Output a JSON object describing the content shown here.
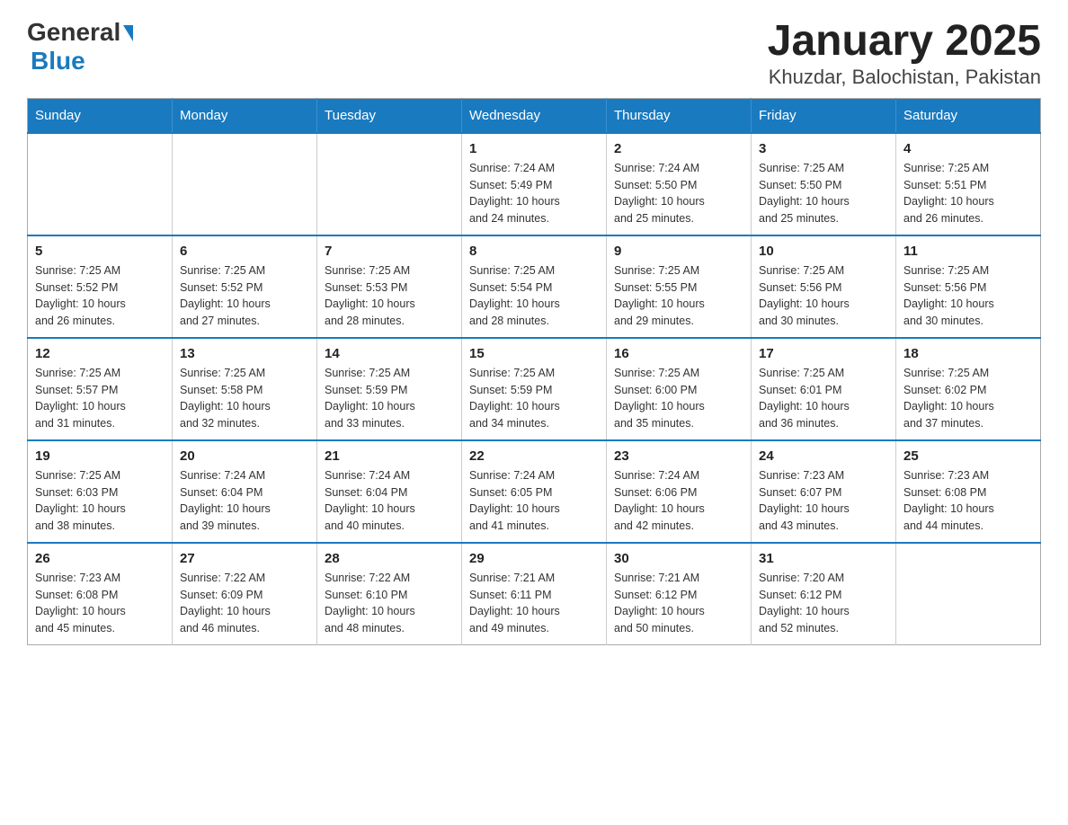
{
  "header": {
    "logo": {
      "general": "General",
      "blue": "Blue"
    },
    "title": "January 2025",
    "subtitle": "Khuzdar, Balochistan, Pakistan"
  },
  "calendar": {
    "days_of_week": [
      "Sunday",
      "Monday",
      "Tuesday",
      "Wednesday",
      "Thursday",
      "Friday",
      "Saturday"
    ],
    "weeks": [
      [
        {
          "day": "",
          "info": ""
        },
        {
          "day": "",
          "info": ""
        },
        {
          "day": "",
          "info": ""
        },
        {
          "day": "1",
          "info": "Sunrise: 7:24 AM\nSunset: 5:49 PM\nDaylight: 10 hours\nand 24 minutes."
        },
        {
          "day": "2",
          "info": "Sunrise: 7:24 AM\nSunset: 5:50 PM\nDaylight: 10 hours\nand 25 minutes."
        },
        {
          "day": "3",
          "info": "Sunrise: 7:25 AM\nSunset: 5:50 PM\nDaylight: 10 hours\nand 25 minutes."
        },
        {
          "day": "4",
          "info": "Sunrise: 7:25 AM\nSunset: 5:51 PM\nDaylight: 10 hours\nand 26 minutes."
        }
      ],
      [
        {
          "day": "5",
          "info": "Sunrise: 7:25 AM\nSunset: 5:52 PM\nDaylight: 10 hours\nand 26 minutes."
        },
        {
          "day": "6",
          "info": "Sunrise: 7:25 AM\nSunset: 5:52 PM\nDaylight: 10 hours\nand 27 minutes."
        },
        {
          "day": "7",
          "info": "Sunrise: 7:25 AM\nSunset: 5:53 PM\nDaylight: 10 hours\nand 28 minutes."
        },
        {
          "day": "8",
          "info": "Sunrise: 7:25 AM\nSunset: 5:54 PM\nDaylight: 10 hours\nand 28 minutes."
        },
        {
          "day": "9",
          "info": "Sunrise: 7:25 AM\nSunset: 5:55 PM\nDaylight: 10 hours\nand 29 minutes."
        },
        {
          "day": "10",
          "info": "Sunrise: 7:25 AM\nSunset: 5:56 PM\nDaylight: 10 hours\nand 30 minutes."
        },
        {
          "day": "11",
          "info": "Sunrise: 7:25 AM\nSunset: 5:56 PM\nDaylight: 10 hours\nand 30 minutes."
        }
      ],
      [
        {
          "day": "12",
          "info": "Sunrise: 7:25 AM\nSunset: 5:57 PM\nDaylight: 10 hours\nand 31 minutes."
        },
        {
          "day": "13",
          "info": "Sunrise: 7:25 AM\nSunset: 5:58 PM\nDaylight: 10 hours\nand 32 minutes."
        },
        {
          "day": "14",
          "info": "Sunrise: 7:25 AM\nSunset: 5:59 PM\nDaylight: 10 hours\nand 33 minutes."
        },
        {
          "day": "15",
          "info": "Sunrise: 7:25 AM\nSunset: 5:59 PM\nDaylight: 10 hours\nand 34 minutes."
        },
        {
          "day": "16",
          "info": "Sunrise: 7:25 AM\nSunset: 6:00 PM\nDaylight: 10 hours\nand 35 minutes."
        },
        {
          "day": "17",
          "info": "Sunrise: 7:25 AM\nSunset: 6:01 PM\nDaylight: 10 hours\nand 36 minutes."
        },
        {
          "day": "18",
          "info": "Sunrise: 7:25 AM\nSunset: 6:02 PM\nDaylight: 10 hours\nand 37 minutes."
        }
      ],
      [
        {
          "day": "19",
          "info": "Sunrise: 7:25 AM\nSunset: 6:03 PM\nDaylight: 10 hours\nand 38 minutes."
        },
        {
          "day": "20",
          "info": "Sunrise: 7:24 AM\nSunset: 6:04 PM\nDaylight: 10 hours\nand 39 minutes."
        },
        {
          "day": "21",
          "info": "Sunrise: 7:24 AM\nSunset: 6:04 PM\nDaylight: 10 hours\nand 40 minutes."
        },
        {
          "day": "22",
          "info": "Sunrise: 7:24 AM\nSunset: 6:05 PM\nDaylight: 10 hours\nand 41 minutes."
        },
        {
          "day": "23",
          "info": "Sunrise: 7:24 AM\nSunset: 6:06 PM\nDaylight: 10 hours\nand 42 minutes."
        },
        {
          "day": "24",
          "info": "Sunrise: 7:23 AM\nSunset: 6:07 PM\nDaylight: 10 hours\nand 43 minutes."
        },
        {
          "day": "25",
          "info": "Sunrise: 7:23 AM\nSunset: 6:08 PM\nDaylight: 10 hours\nand 44 minutes."
        }
      ],
      [
        {
          "day": "26",
          "info": "Sunrise: 7:23 AM\nSunset: 6:08 PM\nDaylight: 10 hours\nand 45 minutes."
        },
        {
          "day": "27",
          "info": "Sunrise: 7:22 AM\nSunset: 6:09 PM\nDaylight: 10 hours\nand 46 minutes."
        },
        {
          "day": "28",
          "info": "Sunrise: 7:22 AM\nSunset: 6:10 PM\nDaylight: 10 hours\nand 48 minutes."
        },
        {
          "day": "29",
          "info": "Sunrise: 7:21 AM\nSunset: 6:11 PM\nDaylight: 10 hours\nand 49 minutes."
        },
        {
          "day": "30",
          "info": "Sunrise: 7:21 AM\nSunset: 6:12 PM\nDaylight: 10 hours\nand 50 minutes."
        },
        {
          "day": "31",
          "info": "Sunrise: 7:20 AM\nSunset: 6:12 PM\nDaylight: 10 hours\nand 52 minutes."
        },
        {
          "day": "",
          "info": ""
        }
      ]
    ]
  }
}
